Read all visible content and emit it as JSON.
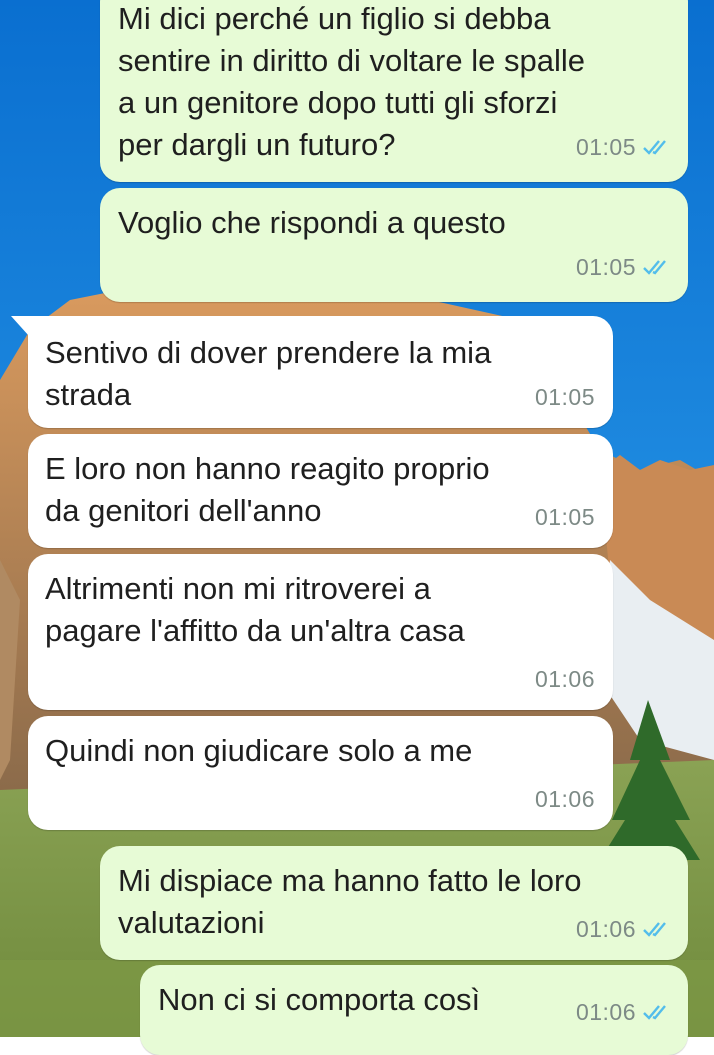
{
  "colors": {
    "outgoing_bubble": "#e7fbd6",
    "incoming_bubble": "#ffffff",
    "read_ticks": "#53bdeb",
    "timestamp": "#7d8a86"
  },
  "wallpaper": {
    "description_icon": "mountain-landscape-wallpaper"
  },
  "messages": [
    {
      "direction": "out",
      "text": "Mi dici perché un figlio si debba\nsentire in diritto di voltare le spalle\na un genitore dopo tutti gli sforzi\nper dargli un futuro?",
      "time": "01:05",
      "status": "read"
    },
    {
      "direction": "out",
      "text": "Voglio che rispondi a questo",
      "time": "01:05",
      "status": "read"
    },
    {
      "direction": "in",
      "text": "Sentivo di dover prendere la mia\nstrada",
      "time": "01:05"
    },
    {
      "direction": "in",
      "text": "E loro non hanno reagito proprio\nda genitori dell'anno",
      "time": "01:05"
    },
    {
      "direction": "in",
      "text": "Altrimenti non mi ritroverei a\npagare l'affitto da un'altra casa",
      "time": "01:06"
    },
    {
      "direction": "in",
      "text": "Quindi non giudicare solo a me",
      "time": "01:06"
    },
    {
      "direction": "out",
      "text": "Mi dispiace ma hanno fatto le loro\nvalutazioni",
      "time": "01:06",
      "status": "read"
    },
    {
      "direction": "out",
      "text": "Non ci si comporta così",
      "time": "01:06",
      "status": "read"
    }
  ]
}
